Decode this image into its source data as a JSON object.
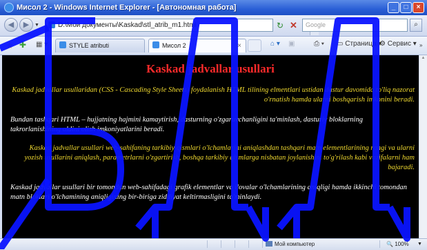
{
  "window": {
    "title": "Мисол 2 - Windows Internet Explorer - [Автономная работа]",
    "min_glyph": "_",
    "max_glyph": "□",
    "close_glyph": "×"
  },
  "address_bar": {
    "url": "D:\\Мои документы\\Kaskad\\stl_atrib_m1.html",
    "search_placeholder": "Google"
  },
  "tabs": [
    {
      "label": "STYLE atributi",
      "active": false
    },
    {
      "label": "Мисол 2",
      "active": true
    }
  ],
  "toolbar": {
    "page_menu": "Страница",
    "tools_menu": "Сервис"
  },
  "page": {
    "heading": "Kaskad jadvallar usullari",
    "paragraphs": [
      "Kaskad jadvallar usullaridan (CSS - Cascading Style Sheets) foydalanish HTML tilining elmentlari ustidan dastur davomida to'liq nazorat o'rnatish hamda ularni boshqarish imkonini beradi.",
      "Bundan tashqari HTML – hujjatning hajmini kamaytirish, dasturning o'zgaruvchanligini ta'minlash, dasturiy bloklarning takrorlanishining oldini olish imkoniyatlarini beradi.",
      "Kaskad jadvallar usullari web-sahifaning tarkibiy qismlari o'lchamlarini aniqlashdan tashqari matn elementlarining rangi va ularni yozish usullarini aniqlash, parametrlarni o'zgartirish, boshqa tarkibiy qismlarga nisbatan joylanishini to'g'rilash kabi vazifalarni ham bajaradi.",
      "Kaskad jadvallar usullari bir tomondan web-sahifadagi grafik elementlar va ilovalar o'lchamlarining aniqligi hamda ikkinchi tomondan matn bloklari o'lchamining aniqligining bir-biriga ziddiyat keltirmasligini ta'minlaydi."
    ],
    "colors": {
      "background": "#000000",
      "heading": "#ff2a2a",
      "accent_text": "#f0d930",
      "plain_text": "#ffffff"
    }
  },
  "status_bar": {
    "zone": "Мой компьютер",
    "zoom": "100%"
  },
  "watermark": {
    "text": "БДД",
    "color": "#0a14ff"
  }
}
